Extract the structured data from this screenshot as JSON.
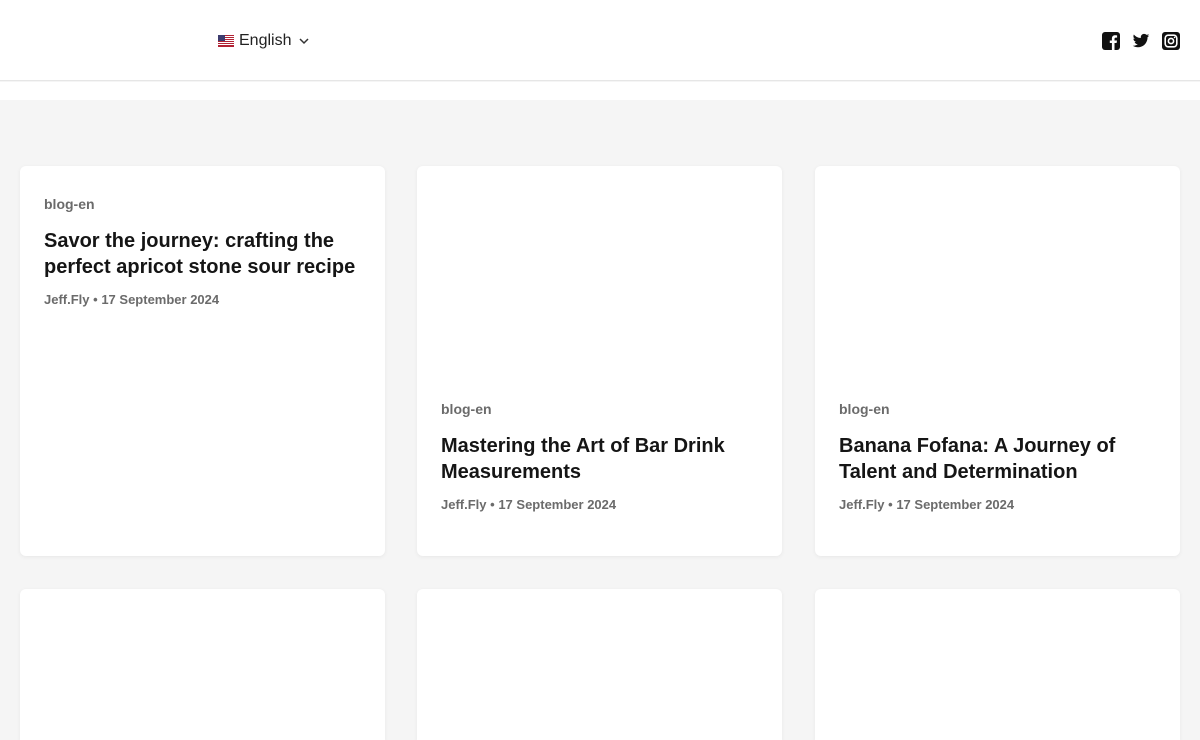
{
  "header": {
    "language": {
      "label": "English",
      "flag": "us-flag-icon"
    },
    "social": [
      {
        "name": "facebook-icon"
      },
      {
        "name": "twitter-icon"
      },
      {
        "name": "instagram-icon"
      }
    ]
  },
  "posts": [
    {
      "category": "blog-en",
      "title": "Savor the journey: crafting the perfect apricot stone sour recipe",
      "author": "Jeff.Fly",
      "date": "17 September 2024"
    },
    {
      "category": "blog-en",
      "title": "Mastering the Art of Bar Drink Measurements",
      "author": "Jeff.Fly",
      "date": "17 September 2024"
    },
    {
      "category": "blog-en",
      "title": "Banana Fofana: A Journey of Talent and Determination",
      "author": "Jeff.Fly",
      "date": "17 September 2024"
    }
  ],
  "meta_separator": "•",
  "colors": {
    "background": "#f5f5f5",
    "card": "#ffffff",
    "meta": "#6b6b6b"
  }
}
